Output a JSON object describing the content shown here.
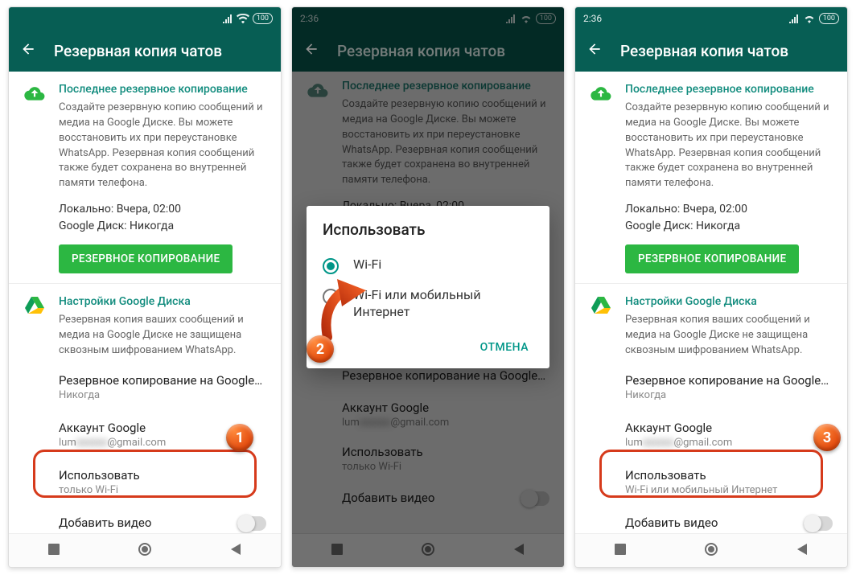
{
  "common": {
    "appbar_title": "Резервная копия чатов",
    "section_last": {
      "title": "Последнее резервное копирование",
      "desc": "Создайте резервную копию сообщений и медиа на Google Диске. Вы можете восстановить их при переустановке WhatsApp. Резервная копия сообщений также будет сохранена во внутренней памяти телефона.",
      "local_line": "Локально: Вчера, 02:00",
      "gdrive_line": "Google Диск: Никогда",
      "button": "Резервное копирование"
    },
    "section_gdrive": {
      "title": "Настройки Google Диска",
      "desc": "Резервная копия ваших сообщений и медиа на Google Диске не защищена сквозным шифрованием WhatsApp."
    },
    "items": {
      "backup_to": {
        "title": "Резервное копирование на Google…",
        "sub": "Никогда"
      },
      "account": {
        "title": "Аккаунт Google",
        "email_prefix": "lum",
        "email_hidden": "xxxxxx",
        "email_suffix": "@gmail.com"
      },
      "use": {
        "title": "Использовать"
      },
      "add_video": "Добавить видео"
    },
    "use_values": {
      "only_wifi": "только Wi-Fi",
      "wifi_or_mobile": "Wi-Fi или мобильный Интернет"
    }
  },
  "phone1": {
    "time": ""
  },
  "phone2": {
    "time": "2:36",
    "dialog": {
      "title": "Использовать",
      "opt1": "Wi-Fi",
      "opt2": "Wi-Fi или мобильный Интернет",
      "cancel": "ОТМЕНА"
    }
  },
  "phone3": {
    "time": "2:36"
  },
  "badges": {
    "b1": "1",
    "b2": "2",
    "b3": "3"
  }
}
